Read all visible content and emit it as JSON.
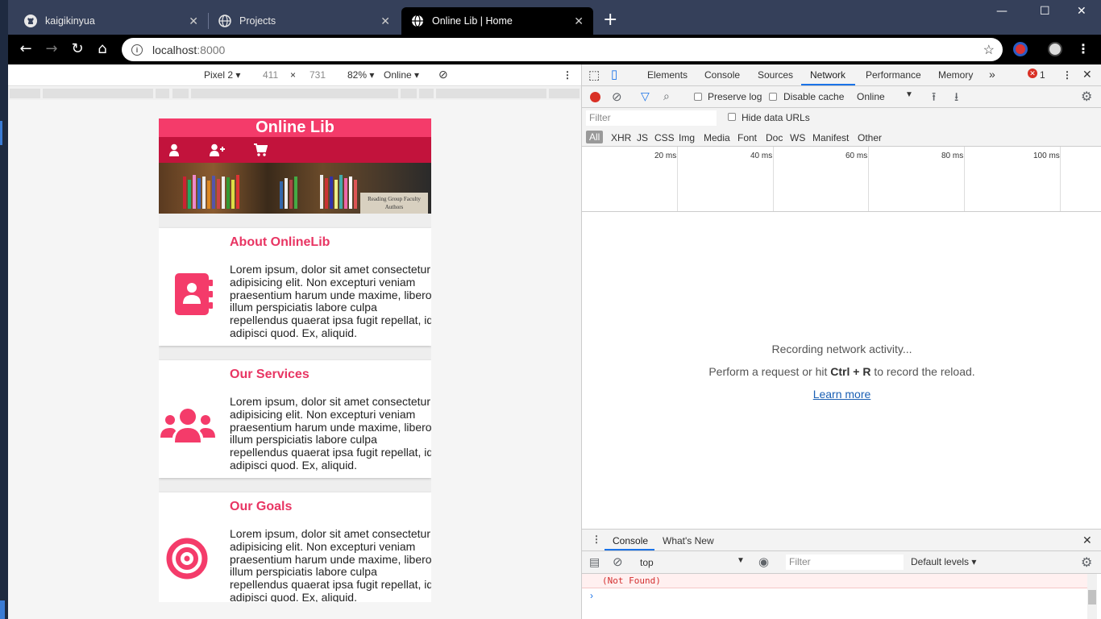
{
  "browser": {
    "tabs": [
      {
        "title": "kaigikinyua"
      },
      {
        "title": "Projects"
      },
      {
        "title": "Online Lib | Home"
      }
    ],
    "url_host": "localhost",
    "url_port": ":8000"
  },
  "device_toolbar": {
    "device": "Pixel 2",
    "width": "411",
    "times": "×",
    "height": "731",
    "zoom": "82%",
    "throttle": "Online"
  },
  "site": {
    "title": "Online Lib",
    "hero_sign": "Reading Group Faculty Authors",
    "cards": [
      {
        "title": "About OnlineLib",
        "body": [
          "Lorem ipsum, dolor sit amet consectetur",
          "adipisicing elit. Non excepturi veniam",
          "praesentium harum unde maxime, libero",
          "illum perspiciatis labore culpa",
          "repellendus quaerat ipsa fugit repellat, id",
          "adipisci quod. Ex, aliquid."
        ]
      },
      {
        "title": "Our Services",
        "body": [
          "Lorem ipsum, dolor sit amet consectetur",
          "adipisicing elit. Non excepturi veniam",
          "praesentium harum unde maxime, libero",
          "illum perspiciatis labore culpa",
          "repellendus quaerat ipsa fugit repellat, id",
          "adipisci quod. Ex, aliquid."
        ]
      },
      {
        "title": "Our Goals",
        "body": [
          "Lorem ipsum, dolor sit amet consectetur",
          "adipisicing elit. Non excepturi veniam",
          "praesentium harum unde maxime, libero",
          "illum perspiciatis labore culpa",
          "repellendus quaerat ipsa fugit repellat, id",
          "adipisci quod. Ex, aliquid."
        ]
      }
    ]
  },
  "devtools": {
    "tabs": [
      "Elements",
      "Console",
      "Sources",
      "Network",
      "Performance",
      "Memory"
    ],
    "more": "»",
    "error_count": "1",
    "toolbar": {
      "preserve_log": "Preserve log",
      "disable_cache": "Disable cache",
      "throttle": "Online"
    },
    "filter_placeholder": "Filter",
    "hide_data_urls": "Hide data URLs",
    "types": [
      "All",
      "XHR",
      "JS",
      "CSS",
      "Img",
      "Media",
      "Font",
      "Doc",
      "WS",
      "Manifest",
      "Other"
    ],
    "timeline_ticks": [
      "20 ms",
      "40 ms",
      "60 ms",
      "80 ms",
      "100 ms"
    ],
    "recording": "Recording network activity...",
    "perform_pre": "Perform a request or hit ",
    "perform_keys": "Ctrl + R",
    "perform_post": " to record the reload.",
    "learn_more": "Learn more",
    "drawer": {
      "tabs": [
        "Console",
        "What's New"
      ],
      "context": "top",
      "filter_placeholder": "Filter",
      "levels": "Default levels",
      "error_text": "(Not Found)",
      "prompt": "›"
    }
  },
  "colors": {
    "brand": "#f43b6a",
    "brand_dark": "#c2133c",
    "accent": "#e83563"
  }
}
